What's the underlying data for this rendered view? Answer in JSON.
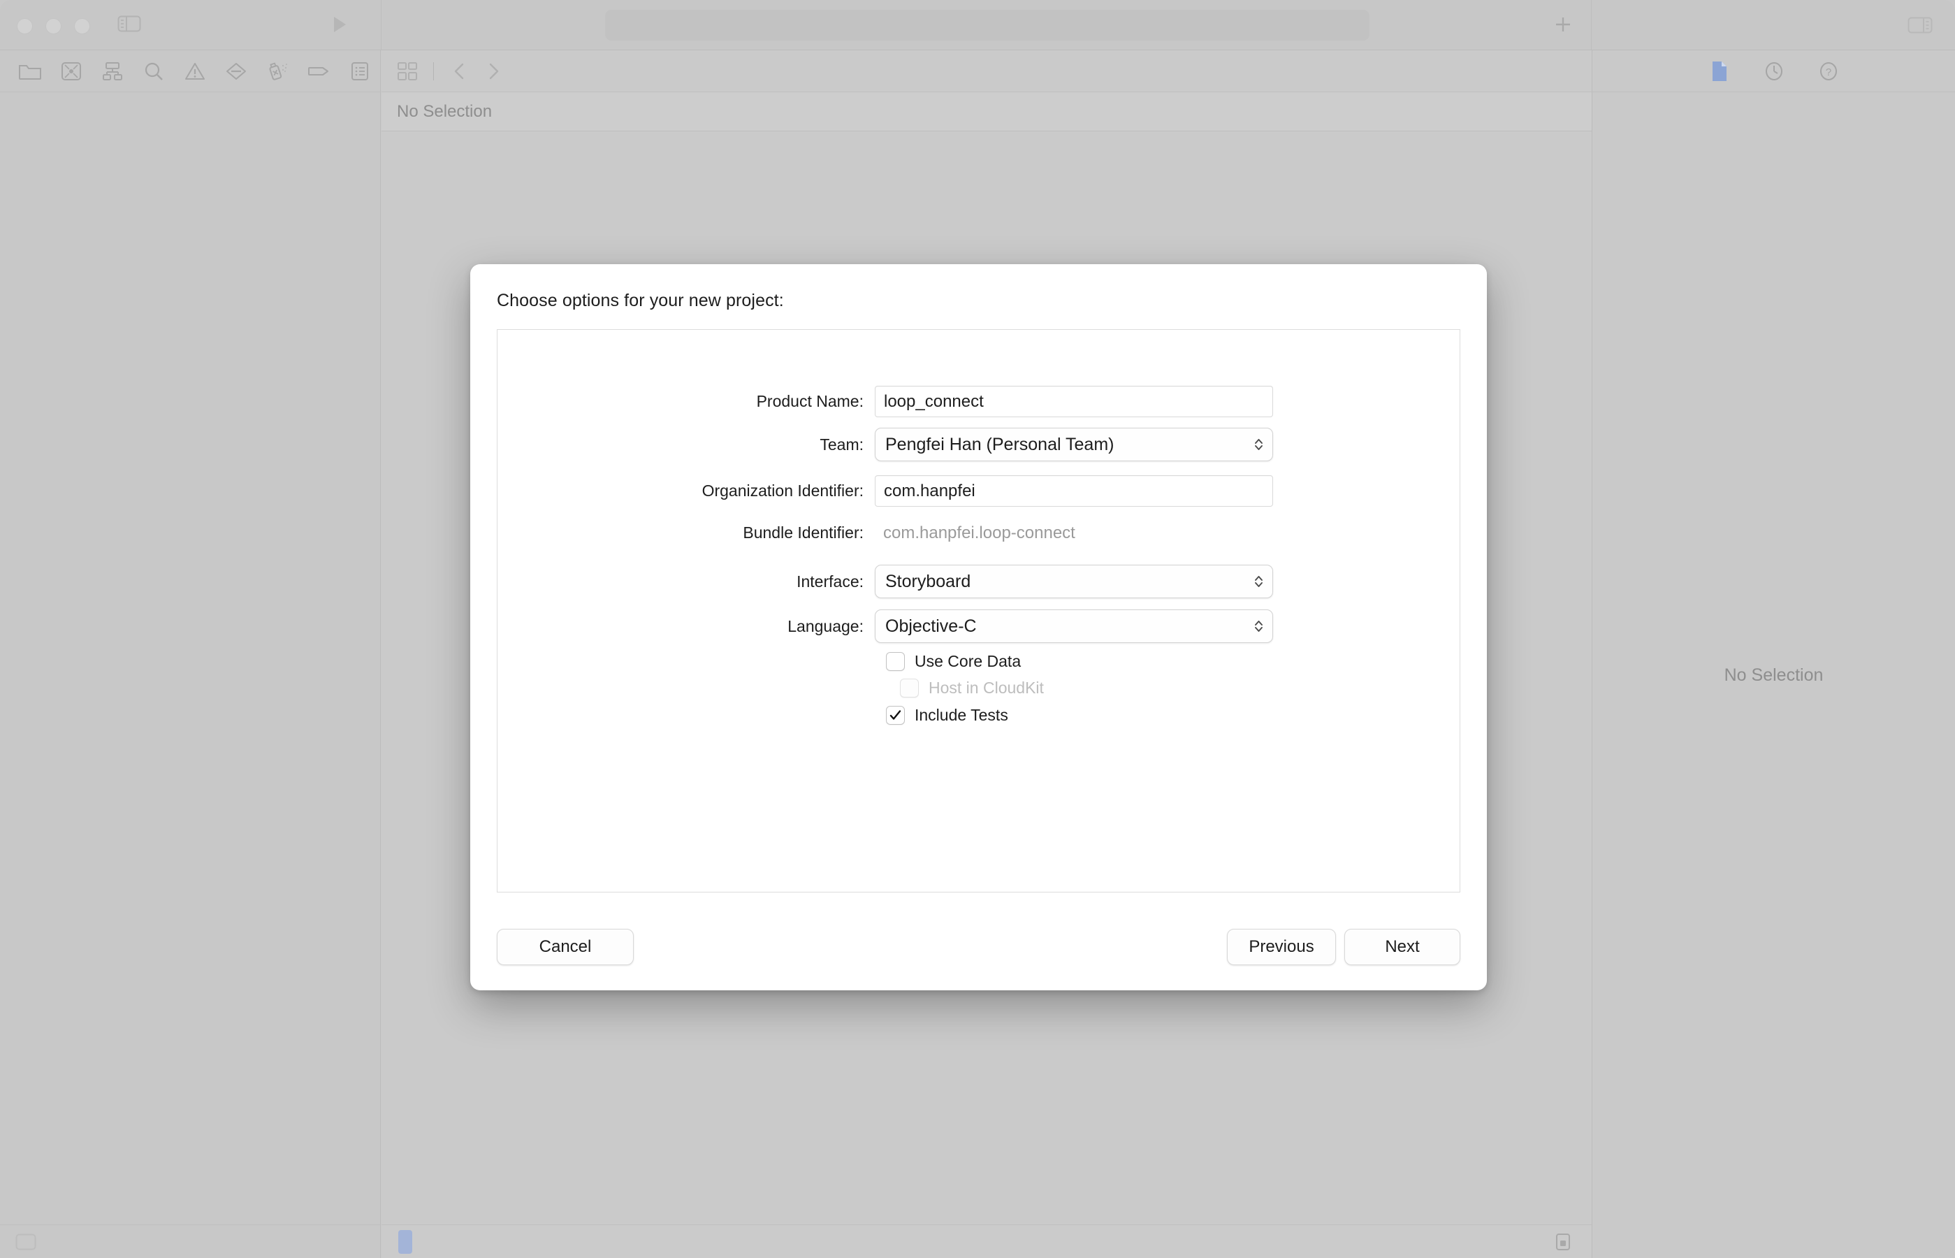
{
  "window": {
    "title_bar": {
      "traffic_lights": [
        "close",
        "minimize",
        "zoom"
      ],
      "sidebar_toggle_icon": "sidebar-left-icon",
      "run_icon": "run-play-icon",
      "add_icon": "plus-icon",
      "inspector_toggle_icon": "sidebar-right-icon"
    },
    "navigator": {
      "icons": [
        "folder-icon",
        "source-control-icon",
        "symbol-hierarchy-icon",
        "search-icon",
        "warning-triangle-icon",
        "breakpoint-icon",
        "test-spray-icon",
        "tag-icon",
        "report-list-icon"
      ],
      "footer_icon": "add-sidebar-item-icon"
    },
    "editor": {
      "toolbar_icons": [
        "editor-options-icon",
        "navigate-back-icon",
        "navigate-forward-icon"
      ],
      "jump_bar_text": "No Selection",
      "status_right_icon": "device-icon"
    },
    "inspector": {
      "toolbar_icons": [
        "file-inspector-icon",
        "history-inspector-icon",
        "help-inspector-icon"
      ],
      "empty_text": "No Selection"
    }
  },
  "sheet": {
    "title": "Choose options for your new project:",
    "fields": [
      {
        "label": "Product Name:",
        "value": "loop_connect",
        "type": "text"
      },
      {
        "label": "Team:",
        "value": "Pengfei Han (Personal Team)",
        "type": "popup"
      },
      {
        "label": "Organization Identifier:",
        "value": "com.hanpfei",
        "type": "text"
      },
      {
        "label": "Bundle Identifier:",
        "value": "com.hanpfei.loop-connect",
        "type": "static"
      },
      {
        "label": "Interface:",
        "value": "Storyboard",
        "type": "popup"
      },
      {
        "label": "Language:",
        "value": "Objective-C",
        "type": "popup"
      }
    ],
    "checkboxes": [
      {
        "label": "Use Core Data",
        "checked": false,
        "disabled": false,
        "indented": false
      },
      {
        "label": "Host in CloudKit",
        "checked": false,
        "disabled": true,
        "indented": true
      },
      {
        "label": "Include Tests",
        "checked": true,
        "disabled": false,
        "indented": false
      }
    ],
    "buttons": {
      "cancel": "Cancel",
      "previous": "Previous",
      "next": "Next"
    }
  },
  "colors": {
    "chrome": "#c9c9c9",
    "sheet_bg": "#ffffff",
    "text": "#1d1d1d",
    "muted_text": "#9a9a9a",
    "accent_marker": "#a3b4d8",
    "file_icon_blue": "#8ba4d4"
  }
}
